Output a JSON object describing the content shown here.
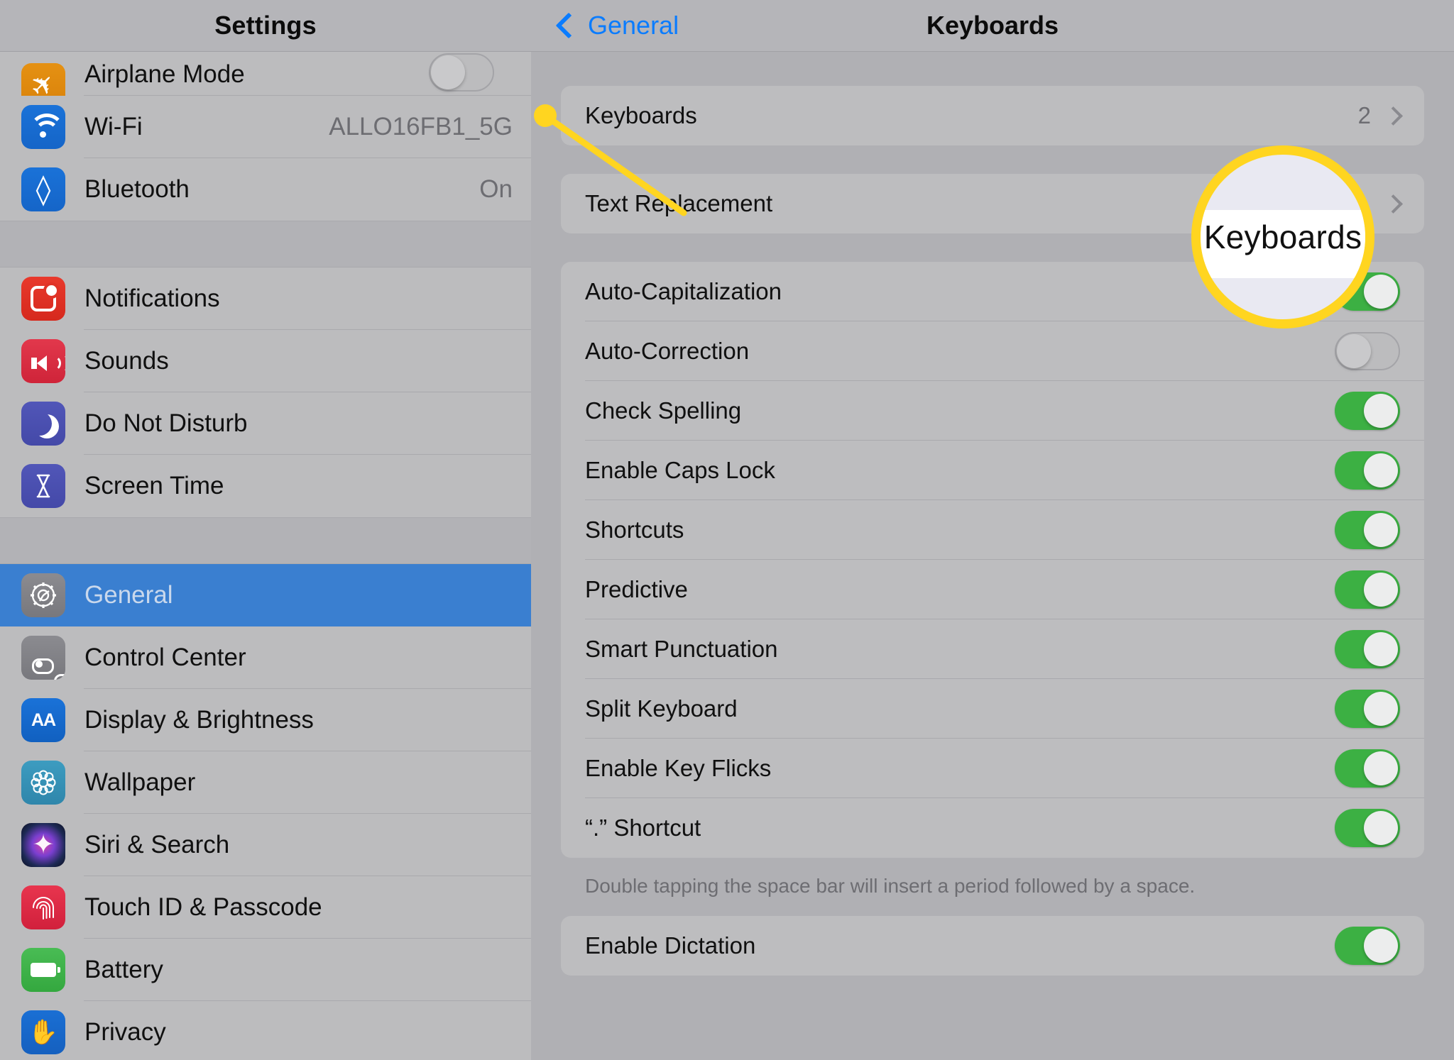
{
  "sidebar": {
    "title": "Settings",
    "items": [
      {
        "label": "Airplane Mode",
        "value": "",
        "icon": "airplane-icon",
        "toggle": "off",
        "clipped": true
      },
      {
        "label": "Wi-Fi",
        "value": "ALLO16FB1_5G",
        "icon": "wifi-icon"
      },
      {
        "label": "Bluetooth",
        "value": "On",
        "icon": "bluetooth-icon"
      },
      {
        "label": "Notifications",
        "value": "",
        "icon": "notifications-icon"
      },
      {
        "label": "Sounds",
        "value": "",
        "icon": "sounds-icon"
      },
      {
        "label": "Do Not Disturb",
        "value": "",
        "icon": "moon-icon"
      },
      {
        "label": "Screen Time",
        "value": "",
        "icon": "hourglass-icon"
      },
      {
        "label": "General",
        "value": "",
        "icon": "gear-icon",
        "selected": true
      },
      {
        "label": "Control Center",
        "value": "",
        "icon": "control-center-icon"
      },
      {
        "label": "Display & Brightness",
        "value": "",
        "icon": "display-brightness-icon"
      },
      {
        "label": "Wallpaper",
        "value": "",
        "icon": "wallpaper-icon"
      },
      {
        "label": "Siri & Search",
        "value": "",
        "icon": "siri-icon"
      },
      {
        "label": "Touch ID & Passcode",
        "value": "",
        "icon": "fingerprint-icon"
      },
      {
        "label": "Battery",
        "value": "",
        "icon": "battery-icon"
      },
      {
        "label": "Privacy",
        "value": "",
        "icon": "privacy-hand-icon"
      }
    ]
  },
  "detail": {
    "back_label": "General",
    "title": "Keyboards",
    "group1": [
      {
        "label": "Keyboards",
        "value": "2",
        "chevron": true
      }
    ],
    "group2": [
      {
        "label": "Text Replacement",
        "value": "",
        "chevron": true
      }
    ],
    "group3": [
      {
        "label": "Auto-Capitalization",
        "toggle": "on"
      },
      {
        "label": "Auto-Correction",
        "toggle": "off"
      },
      {
        "label": "Check Spelling",
        "toggle": "on"
      },
      {
        "label": "Enable Caps Lock",
        "toggle": "on"
      },
      {
        "label": "Shortcuts",
        "toggle": "on"
      },
      {
        "label": "Predictive",
        "toggle": "on"
      },
      {
        "label": "Smart Punctuation",
        "toggle": "on"
      },
      {
        "label": "Split Keyboard",
        "toggle": "on"
      },
      {
        "label": "Enable Key Flicks",
        "toggle": "on"
      },
      {
        "label": "“.” Shortcut",
        "toggle": "on"
      }
    ],
    "footnote": "Double tapping the space bar will insert a period followed by a space.",
    "group4": [
      {
        "label": "Enable Dictation",
        "toggle": "on"
      }
    ]
  },
  "callout": {
    "magnified_label": "Keyboards",
    "accent_color": "#ffd520"
  }
}
